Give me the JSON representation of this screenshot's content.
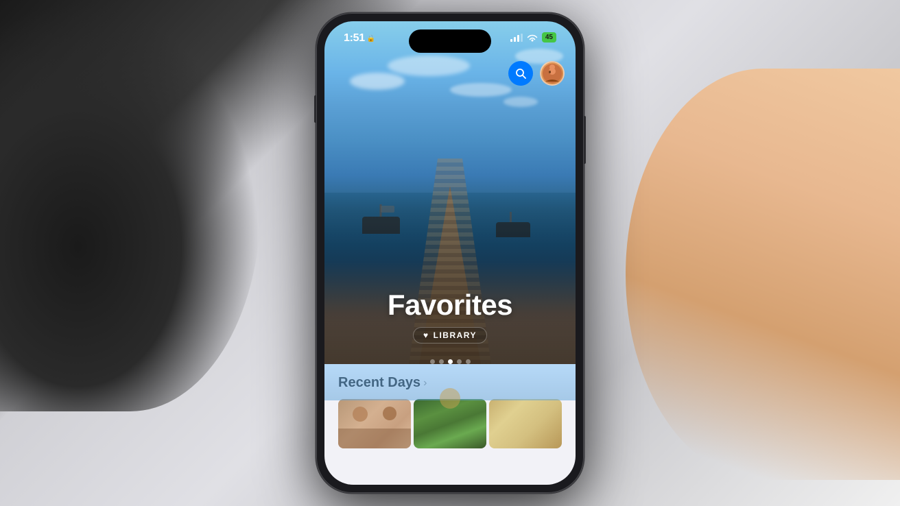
{
  "background": {
    "color": "#c8c8cc"
  },
  "phone": {
    "status_bar": {
      "time": "1:51",
      "battery_level": "45",
      "lock_icon": "🔒"
    },
    "photo_card": {
      "title": "Favorites",
      "subtitle_icon": "♥",
      "subtitle_text": "LIBRARY",
      "dots_count": 5,
      "active_dot": 2
    },
    "top_actions": {
      "search_label": "search",
      "avatar_label": "profile"
    },
    "bottom_section": {
      "recent_days_label": "Recent Days",
      "chevron": "›",
      "thumbnails": [
        {
          "id": 1,
          "alt": "people photo"
        },
        {
          "id": 2,
          "alt": "nature photo"
        },
        {
          "id": 3,
          "alt": "landscape photo"
        }
      ]
    }
  }
}
